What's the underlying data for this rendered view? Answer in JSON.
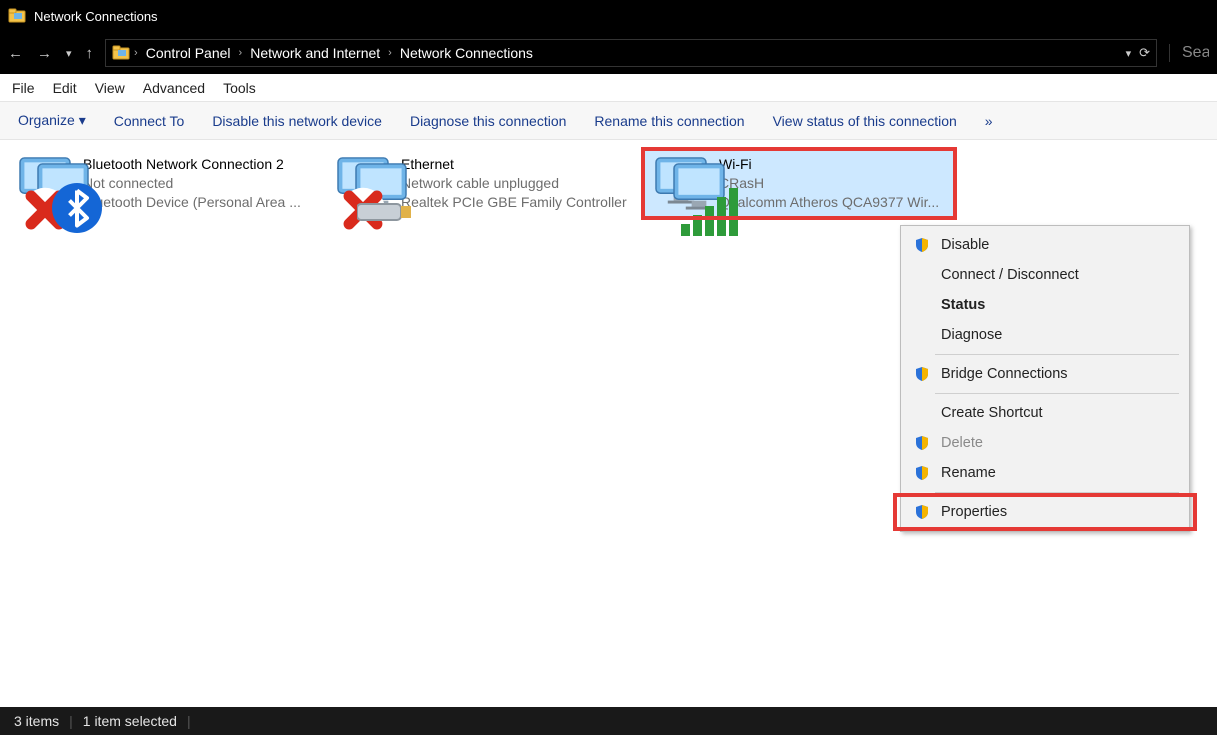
{
  "title": "Network Connections",
  "breadcrumbs": [
    "Control Panel",
    "Network and Internet",
    "Network Connections"
  ],
  "search_placeholder": "Sear",
  "menubar": {
    "file": "File",
    "edit": "Edit",
    "view": "View",
    "advanced": "Advanced",
    "tools": "Tools"
  },
  "toolbar": {
    "organize": "Organize ▾",
    "connect": "Connect To",
    "disable": "Disable this network device",
    "diagnose": "Diagnose this connection",
    "rename": "Rename this connection",
    "viewstatus": "View status of this connection",
    "overflow": "»"
  },
  "connections": [
    {
      "name": "Bluetooth Network Connection 2",
      "status": "Not connected",
      "device": "Bluetooth Device (Personal Area ...",
      "kind": "bluetooth"
    },
    {
      "name": "Ethernet",
      "status": "Network cable unplugged",
      "device": "Realtek PCIe GBE Family Controller",
      "kind": "ethernet"
    },
    {
      "name": "Wi-Fi",
      "status": "CRasH",
      "device": "Qualcomm Atheros QCA9377 Wir...",
      "kind": "wifi"
    }
  ],
  "context_menu": {
    "disable": "Disable",
    "connect": "Connect / Disconnect",
    "status": "Status",
    "diagnose": "Diagnose",
    "bridge": "Bridge Connections",
    "shortcut": "Create Shortcut",
    "delete": "Delete",
    "rename": "Rename",
    "properties": "Properties"
  },
  "statusbar": {
    "items": "3 items",
    "selected": "1 item selected"
  }
}
